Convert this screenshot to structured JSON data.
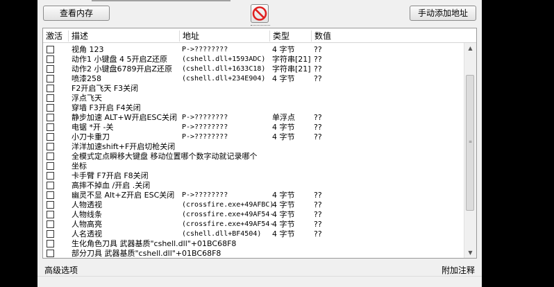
{
  "toolbar": {
    "view_memory_label": "查看内存",
    "add_address_label": "手动添加地址"
  },
  "columns": [
    "激活",
    "描述",
    "地址",
    "类型",
    "数值"
  ],
  "rows": [
    {
      "desc": "视角  123",
      "addr": "P->????????",
      "type": "4 字节",
      "val": "??"
    },
    {
      "desc": "动作1  小键盘 4 5开启Z还原",
      "addr": "(cshell.dll+1593ADC)",
      "type": "字符串[21]",
      "val": "??"
    },
    {
      "desc": "动作2  小键盘6789开启Z还原",
      "addr": "(cshell.dll+1633C18)",
      "type": "字符串[21]",
      "val": "??"
    },
    {
      "desc": "喷漆258",
      "addr": "(cshell.dll+234E904)",
      "type": "4 字节",
      "val": "??"
    },
    {
      "desc": "F2开启飞天  F3关闭",
      "addr": "",
      "type": "",
      "val": ""
    },
    {
      "desc": "浮点飞天",
      "addr": "",
      "type": "",
      "val": ""
    },
    {
      "desc": "穿墙  F3开启  F4关闭",
      "addr": "",
      "type": "",
      "val": ""
    },
    {
      "desc": "静步加速  ALT+W开启ESC关闭",
      "addr": "P->????????",
      "type": "单浮点",
      "val": "??"
    },
    {
      "desc": "电锯  *开 -关",
      "addr": "P->????????",
      "type": "4 字节",
      "val": "??"
    },
    {
      "desc": "小刀卡重刀",
      "addr": "P->????????",
      "type": "4 字节",
      "val": "??"
    },
    {
      "desc": "洋洋加速shift+F开启切枪关闭",
      "addr": "",
      "type": "",
      "val": ""
    },
    {
      "desc": "全模式定点瞬移大键盘  移动位置哪个数字动就记录哪个",
      "addr": "",
      "type": "",
      "val": ""
    },
    {
      "desc": "坐标",
      "addr": "",
      "type": "",
      "val": ""
    },
    {
      "desc": "卡手臂  F7开启 F8关闭",
      "addr": "",
      "type": "",
      "val": ""
    },
    {
      "desc": "高摔不掉血  /开启 .关闭",
      "addr": "",
      "type": "",
      "val": ""
    },
    {
      "desc": "幽灵不显 Alt+Z开启 ESC关闭",
      "addr": "P->????????",
      "type": "4 字节",
      "val": "??"
    },
    {
      "desc": "人物透视",
      "addr": "(crossfire.exe+49AFBC)",
      "type": "4 字节",
      "val": "??"
    },
    {
      "desc": "人物线条",
      "addr": "(crossfire.exe+49AF54-",
      "type": "4 字节",
      "val": "??"
    },
    {
      "desc": "人物高亮",
      "addr": "(crossfire.exe+49AF54-",
      "type": "4 字节",
      "val": "??"
    },
    {
      "desc": "人名透视",
      "addr": "(cshell.dll+BF4504)",
      "type": "4 字节",
      "val": "??"
    },
    {
      "desc": "生化角色刀具    武器基质\"cshell.dll\"+01BC68F8",
      "addr": "",
      "type": "",
      "val": ""
    },
    {
      "desc": "部分刀具    武器基质\"cshell.dll\"+01BC68F8",
      "addr": "",
      "type": "",
      "val": ""
    }
  ],
  "status": {
    "advanced_label": "高级选项",
    "comment_label": "附加注释"
  },
  "icons": {
    "clear_icon": "no-entry-icon",
    "clear_color": "#e02020"
  }
}
